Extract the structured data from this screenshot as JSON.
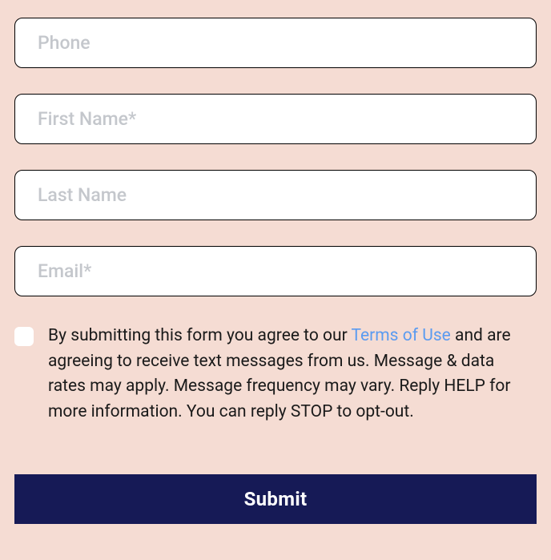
{
  "fields": {
    "phone": {
      "placeholder": "Phone",
      "value": ""
    },
    "firstName": {
      "placeholder": "First Name*",
      "value": ""
    },
    "lastName": {
      "placeholder": "Last Name",
      "value": ""
    },
    "email": {
      "placeholder": "Email*",
      "value": ""
    }
  },
  "consent": {
    "checked": false,
    "pre": "By submitting this form you agree to our ",
    "link": "Terms of Use",
    "post": " and are agreeing to receive text messages from us. Message & data rates may apply. Message frequency may vary. Reply HELP for more information. You can reply STOP to opt-out."
  },
  "submitLabel": "Submit"
}
